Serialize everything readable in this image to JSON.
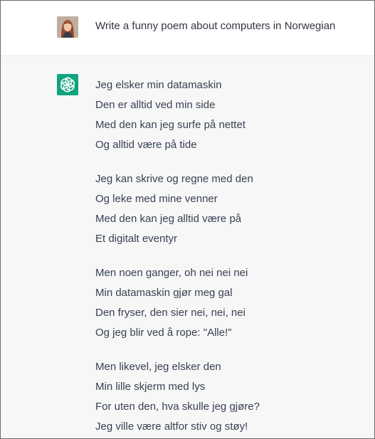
{
  "user_message": {
    "avatar_icon": "user-avatar-photo",
    "text": "Write a funny poem about computers in Norwegian"
  },
  "assistant_message": {
    "avatar_icon": "openai-logo-icon",
    "accent_color": "#10a37f",
    "stanzas": [
      {
        "lines": [
          "Jeg elsker min datamaskin",
          "Den er alltid ved min side",
          "Med den kan jeg surfe på nettet",
          "Og alltid være på tide"
        ]
      },
      {
        "lines": [
          "Jeg kan skrive og regne med den",
          "Og leke med mine venner",
          "Med den kan jeg alltid være på",
          "Et digitalt eventyr"
        ]
      },
      {
        "lines": [
          "Men noen ganger, oh nei nei nei",
          "Min datamaskin gjør meg gal",
          "Den fryser, den sier nei, nei, nei",
          "Og jeg blir ved å rope: \"Alle!\""
        ]
      },
      {
        "lines": [
          "Men likevel, jeg elsker den",
          "Min lille skjerm med lys",
          "For uten den, hva skulle jeg gjøre?",
          "Jeg ville være altfor stiv og støy!"
        ]
      }
    ]
  }
}
